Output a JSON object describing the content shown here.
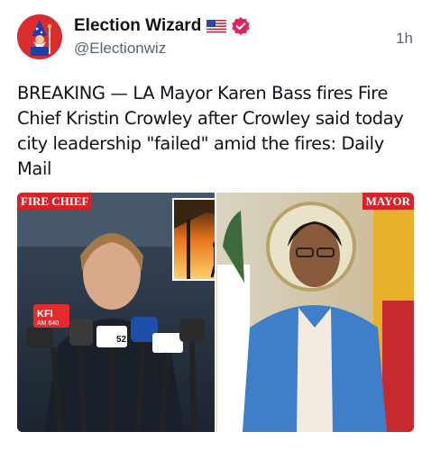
{
  "account": {
    "display_name": "Election Wizard",
    "handle": "@Electionwiz",
    "timestamp": "1h",
    "flag_icon": "us-flag-icon",
    "verified_icon": "verified-badge-icon",
    "verified_color": "#e0245e"
  },
  "post": {
    "text": "BREAKING — LA Mayor Karen Bass fires Fire Chief Kristin Crowley after Crowley said today city leadership \"failed\" amid the fires: Daily Mail"
  },
  "media": {
    "label_left": "FIRE CHIEF",
    "label_right": "MAYOR",
    "mic_labels": {
      "kfi": "KFI",
      "kfi_sub": "AM 640",
      "t52": "52"
    },
    "accent_red": "#d4232b"
  }
}
